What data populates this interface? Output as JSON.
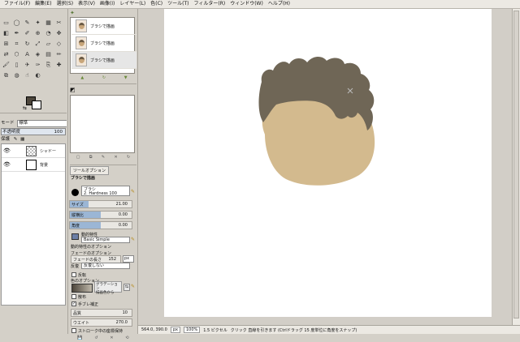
{
  "menubar": {
    "items": [
      "ファイル(F)",
      "編集(E)",
      "選択(S)",
      "表示(V)",
      "画像(I)",
      "レイヤー(L)",
      "色(C)",
      "ツール(T)",
      "フィルター(R)",
      "ウィンドウ(W)",
      "ヘルプ(H)"
    ]
  },
  "toolbox": {
    "mode_label": "モード",
    "mode_value": "標準",
    "opacity_label": "不透明度",
    "opacity_value": "100",
    "lock_label": "保護",
    "layers": [
      {
        "name": "シャドー"
      },
      {
        "name": "背景"
      }
    ],
    "colors": {
      "foreground": "#4d463c",
      "background": "#ffffff"
    }
  },
  "brushes": {
    "items": [
      {
        "label": "ブラシで描画"
      },
      {
        "label": "ブラシで描画"
      },
      {
        "label": "ブラシで描画"
      }
    ]
  },
  "tool_options": {
    "tab_label": "ツールオプション",
    "title": "ブラシで描画",
    "brush_label": "ブラシ",
    "brush_value": "2. Hardness 100",
    "sliders": [
      {
        "label": "サイズ",
        "value": "21.00",
        "fraction": 0.3
      },
      {
        "label": "縦横比",
        "value": "0.00",
        "fraction": 0.5
      },
      {
        "label": "角度",
        "value": "0.00",
        "fraction": 0.5
      }
    ],
    "dynamics_label": "動的特性",
    "dynamics_value": "Basic Simple",
    "dynamics_options": "動的特性のオプション",
    "fade_options": "フェードのオプション",
    "fade_length_label": "フェードの長さ",
    "fade_length_value": "152",
    "fade_unit": "px",
    "repeat_label": "反復",
    "repeat_value": "反復しない",
    "reverse_label": "反転",
    "color_options": "色のオプション",
    "gradient_label": "グラデーション",
    "gradient_value": "描画色から",
    "jitter_label": "散布",
    "smooth_label": "手ブレ補正",
    "quality_label": "品質",
    "quality_value": "10",
    "weight_label": "ウエイト",
    "weight_value": "270.0",
    "stroke_label": "ストローク中の座標保持"
  },
  "canvas": {
    "colors": {
      "skin": "#d3ba8e",
      "hair": "#6f6656"
    }
  },
  "statusbar": {
    "coords": "564.0, 390.0",
    "unit": "px",
    "zoom": "100%",
    "size": "1.5 ピクセル",
    "message": "クリック 直線を引きます (Ctrlドラッグ 15 度単位に角度をスナップ)"
  }
}
